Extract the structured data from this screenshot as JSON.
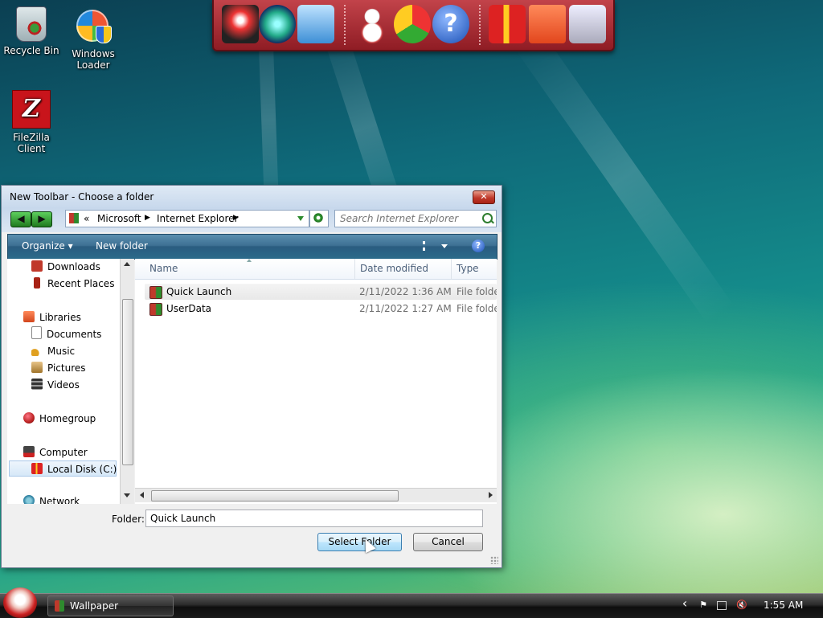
{
  "desktop": {
    "icons": [
      {
        "label": "Recycle Bin",
        "icon": "recycle-bin-icon"
      },
      {
        "label": "Windows Loader",
        "icon": "windows-logo-icon"
      },
      {
        "label": "FileZilla Client",
        "icon": "filezilla-icon"
      }
    ]
  },
  "quickbar": {
    "icons": [
      "desktop-icon",
      "globe-icon",
      "network-icon",
      "snowman-icon",
      "chrome-icon",
      "help-icon",
      "gift-icon",
      "folder-icon",
      "recycle-bin-icon"
    ]
  },
  "dialog": {
    "title": "New Toolbar - Choose a folder",
    "close_label": "✕",
    "back_label": "◀",
    "forward_label": "▶",
    "breadcrumb": {
      "overflow": "«",
      "items": [
        "Microsoft",
        "Internet Explorer"
      ]
    },
    "search": {
      "placeholder": "Search Internet Explorer"
    },
    "toolbar": {
      "organize": "Organize ▾",
      "new_folder": "New folder",
      "help": "?"
    },
    "nav": {
      "items": [
        {
          "label": "Downloads",
          "icon": "downloads-icon"
        },
        {
          "label": "Recent Places",
          "icon": "recent-places-icon"
        },
        {
          "label": "Libraries",
          "icon": "libraries-icon"
        },
        {
          "label": "Documents",
          "icon": "documents-icon"
        },
        {
          "label": "Music",
          "icon": "music-icon"
        },
        {
          "label": "Pictures",
          "icon": "pictures-icon"
        },
        {
          "label": "Videos",
          "icon": "videos-icon"
        },
        {
          "label": "Homegroup",
          "icon": "homegroup-icon"
        },
        {
          "label": "Computer",
          "icon": "computer-icon"
        },
        {
          "label": "Local Disk (C:)",
          "icon": "local-disk-icon"
        },
        {
          "label": "Network",
          "icon": "network-icon"
        }
      ]
    },
    "columns": {
      "name": "Name",
      "date": "Date modified",
      "type": "Type"
    },
    "files": [
      {
        "name": "Quick Launch",
        "date": "2/11/2022 1:36 AM",
        "type": "File folder"
      },
      {
        "name": "UserData",
        "date": "2/11/2022 1:27 AM",
        "type": "File folder"
      }
    ],
    "folder_label": "Folder:",
    "folder_value": "Quick Launch",
    "select_button": "Select Folder",
    "cancel_button": "Cancel"
  },
  "taskbar": {
    "window_button": "Wallpaper",
    "clock": "1:55 AM",
    "tray_expand": "‹"
  }
}
